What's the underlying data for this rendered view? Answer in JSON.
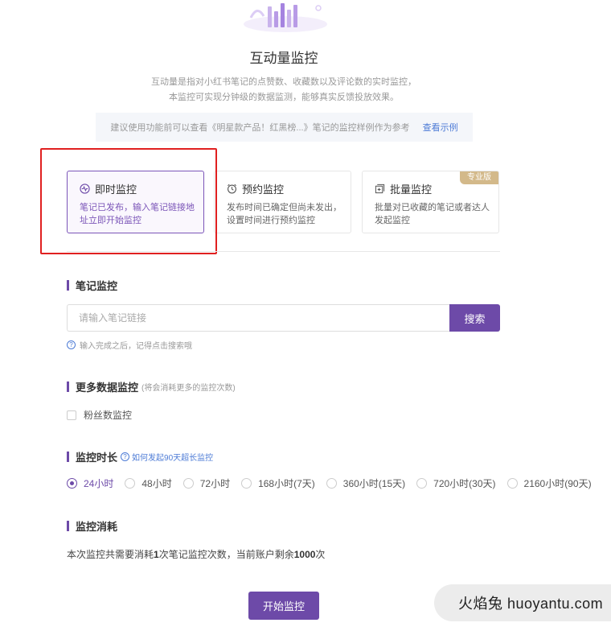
{
  "header": {
    "title": "互动量监控",
    "desc_line1": "互动量是指对小红书笔记的点赞数、收藏数以及评论数的实时监控，",
    "desc_line2": "本监控可实现分钟级的数据监测，能够真实反馈投放效果。",
    "tip_text": "建议使用功能前可以查看《明星款产品！红黑榜...》笔记的监控样例作为参考",
    "tip_link": "查看示例"
  },
  "modes": [
    {
      "title": "即时监控",
      "desc": "笔记已发布，输入笔记链接地 址立即开始监控",
      "icon": "pulse-icon",
      "active": true
    },
    {
      "title": "预约监控",
      "desc": "发布时间已确定但尚未发出，设置时间进行预约监控",
      "icon": "alarm-clock-icon",
      "active": false
    },
    {
      "title": "批量监控",
      "desc": "批量对已收藏的笔记或者达人发起监控",
      "icon": "batch-add-icon",
      "active": false,
      "badge": "专业版"
    }
  ],
  "note_monitor": {
    "heading": "笔记监控",
    "placeholder": "请输入笔记链接",
    "search_label": "搜索",
    "hint": "输入完成之后，记得点击搜索哦"
  },
  "more_data": {
    "heading": "更多数据监控",
    "sub": "(将会消耗更多的监控次数)",
    "checkbox_label": "粉丝数监控",
    "checked": false
  },
  "duration": {
    "heading": "监控时长",
    "help": "如何发起90天超长监控",
    "options": [
      "24小时",
      "48小时",
      "72小时",
      "168小时(7天)",
      "360小时(15天)",
      "720小时(30天)",
      "2160小时(90天)"
    ],
    "selected": "24小时"
  },
  "cost": {
    "heading": "监控消耗",
    "prefix": "本次监控共需要消耗",
    "count": "1",
    "middle": "次笔记监控次数，当前账户剩余",
    "remain": "1000",
    "suffix": "次"
  },
  "start_button": "开始监控",
  "watermark": "火焰兔 huoyantu.com",
  "colors": {
    "accent": "#6d4aa8",
    "link": "#4d7bd6",
    "badge": "#d3b98a",
    "highlight": "#e02020"
  }
}
